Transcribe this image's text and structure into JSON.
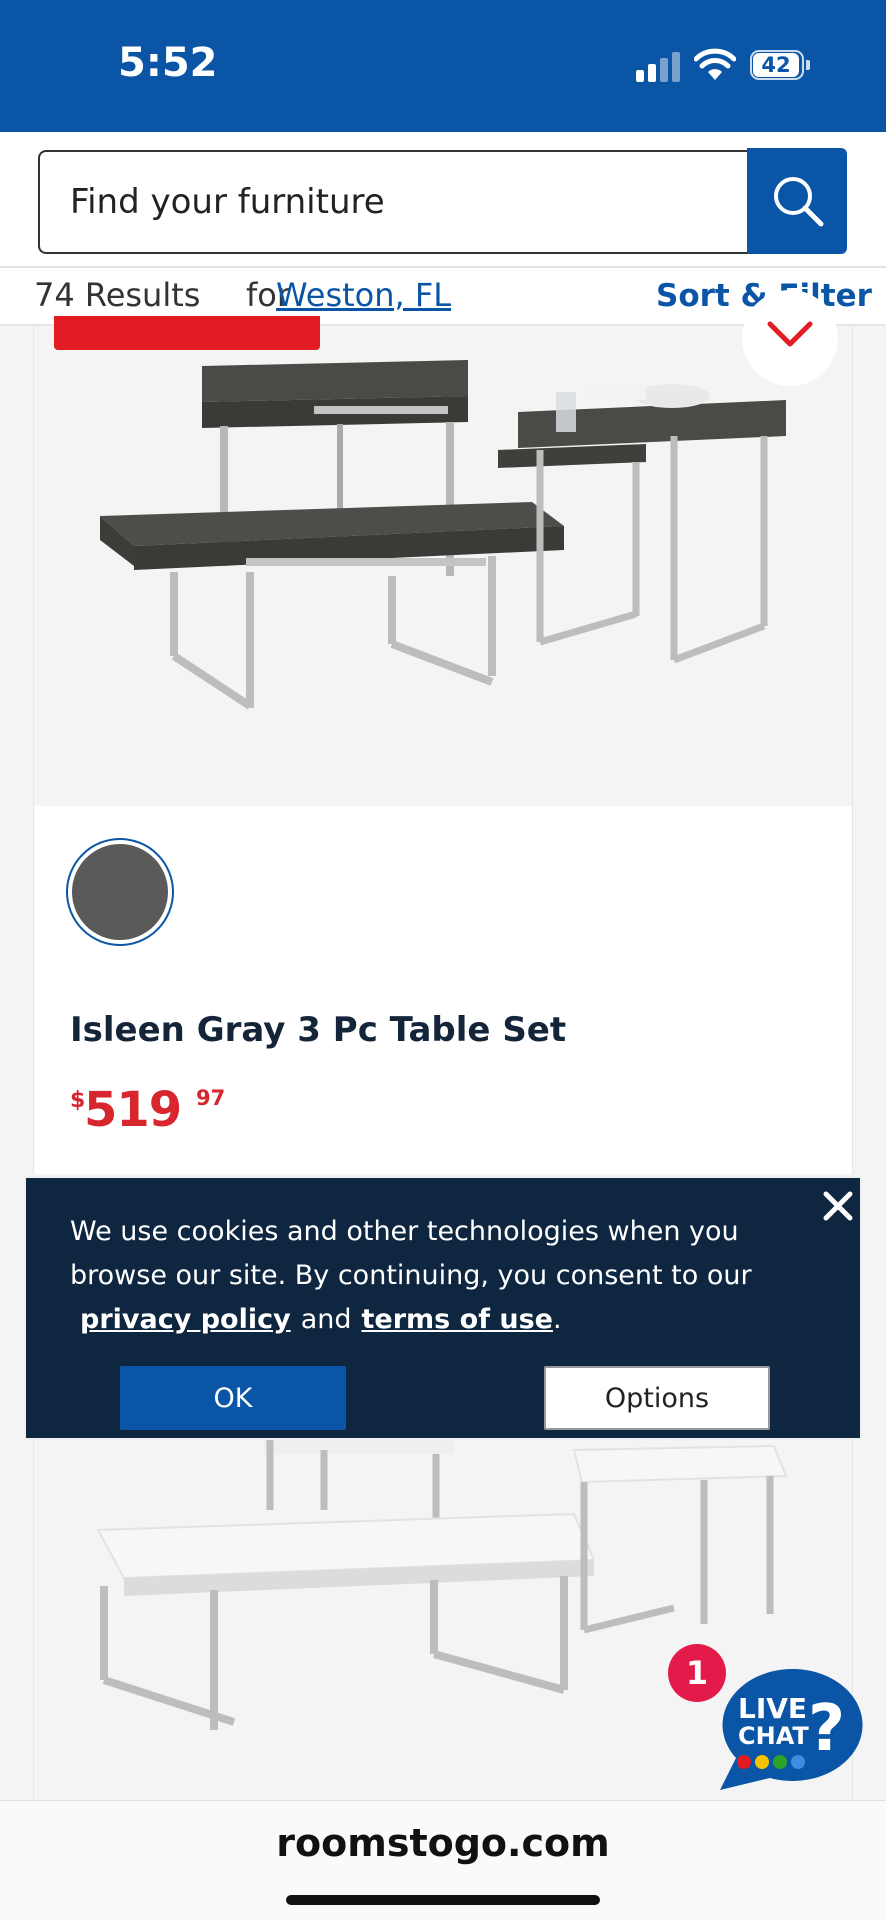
{
  "status_bar": {
    "time": "5:52",
    "battery": "42"
  },
  "search": {
    "placeholder": "Find your furniture"
  },
  "results": {
    "count": "74 Results",
    "for_label": "for",
    "location": "Weston, FL",
    "sort_filter": "Sort & Filter"
  },
  "product": {
    "name": "Isleen Gray 3 Pc Table Set",
    "price_currency": "$",
    "price_dollars": "519",
    "price_cents": "97",
    "swatch_color": "#5a5a58"
  },
  "cookie": {
    "text": "We use cookies and other technologies when you browse our site. By continuing, you consent to our",
    "privacy_link": "privacy policy",
    "and": "and",
    "terms_link": "terms of use",
    "period": ".",
    "ok_label": "OK",
    "options_label": "Options"
  },
  "chat": {
    "badge_count": "1",
    "label_line1": "LIVE",
    "label_line2": "CHAT"
  },
  "browser": {
    "url": "roomstogo.com"
  },
  "colors": {
    "brand_blue": "#0b55a6",
    "sale_red": "#e31b23",
    "banner_navy": "#0e2640"
  }
}
